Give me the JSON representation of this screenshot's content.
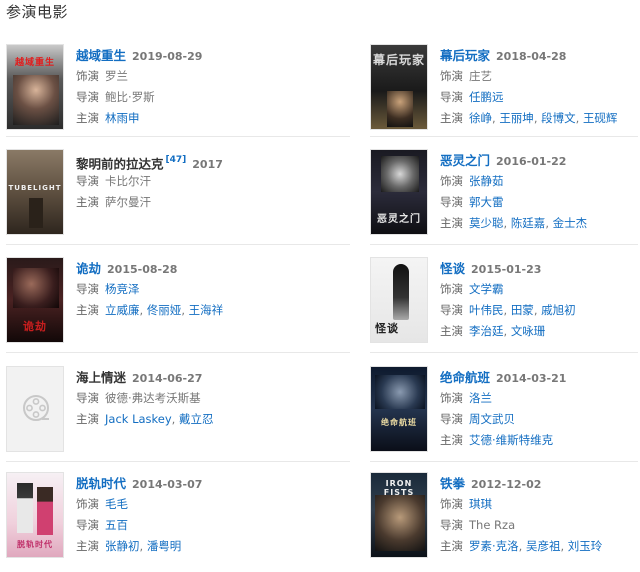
{
  "section_title": "参演电影",
  "labels": {
    "role": "饰演",
    "director": "导演",
    "cast": "主演"
  },
  "movies": [
    {
      "title": "越域重生",
      "date": "2019-08-29",
      "role": "罗兰",
      "director": "鲍比·罗斯",
      "cast": [
        "林雨申"
      ],
      "poster_text": "越域重生"
    },
    {
      "title": "幕后玩家",
      "date": "2018-04-28",
      "role": "庄艺",
      "director": "任鹏远",
      "cast": [
        "徐峥",
        "王丽坤",
        "段博文",
        "王砚辉"
      ],
      "poster_text": "幕后玩家"
    },
    {
      "title": "黎明前的拉达克",
      "cite": "[47]",
      "date": "2017",
      "director": "卡比尔汗",
      "cast_plain": "萨尔曼汗",
      "poster_text": "TUBELIGHT"
    },
    {
      "title": "恶灵之门",
      "date": "2016-01-22",
      "role": "张静茹",
      "director": "郭大雷",
      "cast": [
        "莫少聪",
        "陈廷嘉",
        "金士杰"
      ],
      "poster_text": "恶灵之门"
    },
    {
      "title": "诡劫",
      "date": "2015-08-28",
      "director": "杨竞泽",
      "cast": [
        "立威廉",
        "佟丽娅",
        "王海祥"
      ],
      "poster_text": "诡劫"
    },
    {
      "title": "怪谈",
      "date": "2015-01-23",
      "role": "文学霸",
      "director": "叶伟民",
      "director_more": [
        "田蒙",
        "戚旭初"
      ],
      "cast": [
        "李治廷",
        "文咏珊"
      ],
      "poster_text": "怪谈"
    },
    {
      "title": "海上情迷",
      "date": "2014-06-27",
      "director": "彼德·弗达考沃斯基",
      "cast": [
        "Jack Laskey",
        "戴立忍"
      ],
      "plain_title": true
    },
    {
      "title": "绝命航班",
      "date": "2014-03-21",
      "role": "洛兰",
      "director": "周文武贝",
      "cast": [
        "艾德·维斯特维克"
      ],
      "poster_text": "绝命航班"
    },
    {
      "title": "脱轨时代",
      "date": "2014-03-07",
      "role": "毛毛",
      "director": "五百",
      "cast": [
        "张静初",
        "潘粤明"
      ],
      "poster_text": "脱轨时代"
    },
    {
      "title": "铁拳",
      "date": "2012-12-02",
      "role": "琪琪",
      "director_plain": "The Rza",
      "cast": [
        "罗素·克洛",
        "吴彦祖",
        "刘玉玲"
      ],
      "poster_text": "IRON FISTS"
    }
  ],
  "colors": {
    "link": "#136ec2",
    "label": "#666666",
    "divider": "#e8e8e8"
  }
}
